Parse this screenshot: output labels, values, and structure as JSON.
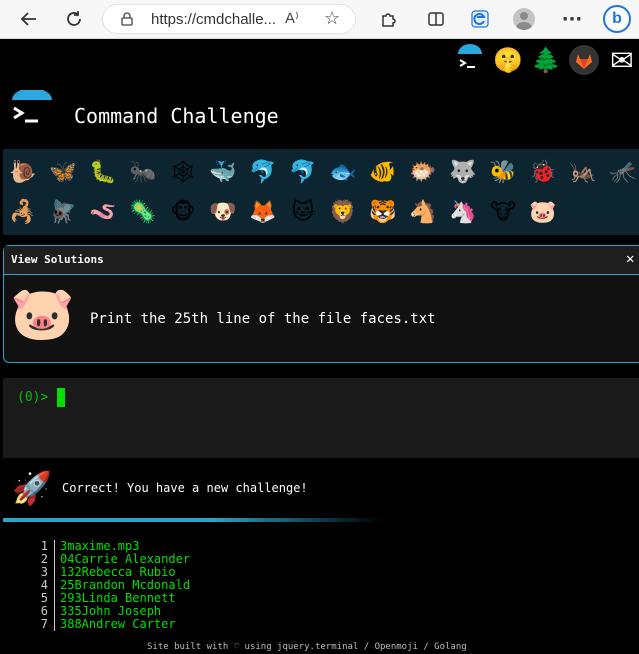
{
  "browser": {
    "url": "https://cmdchalle...",
    "reader_icon": "A⁾",
    "icons": [
      "back-arrow-icon",
      "refresh-icon",
      "lock-icon",
      "star-icon",
      "extensions-icon",
      "split-screen-icon",
      "edge-icon",
      "profile-icon",
      "more-icon",
      "bing-icon"
    ],
    "more": "···",
    "bing": "b"
  },
  "header": {
    "top_icons": [
      {
        "name": "terminal-logo-icon",
        "glyph": ""
      },
      {
        "name": "shushing-face-icon",
        "glyph": "🤫"
      },
      {
        "name": "tree-icon",
        "glyph": "🌲"
      },
      {
        "name": "gitlab-icon",
        "glyph": ""
      },
      {
        "name": "envelope-icon",
        "glyph": "✉"
      }
    ],
    "title": "Command Challenge"
  },
  "emoji_rows": [
    [
      "🐌",
      "🦋",
      "🐛",
      "🐜",
      "🕸",
      "🐳",
      "🐬",
      "🐬",
      "🐟",
      "🐠",
      "🐡",
      "🐺",
      "🐝",
      "🐞",
      "🦗",
      "🦟"
    ],
    [
      "🦂",
      "🪰",
      "🪱",
      "🦠",
      "🐵",
      "🐶",
      "🦊",
      "🐱",
      "🦁",
      "🐯",
      "🐴",
      "🦄",
      "🐮",
      "🐷"
    ]
  ],
  "challenge": {
    "view_solutions": "View Solutions",
    "close": "✕",
    "animal": "🐷",
    "task": "Print the 25th line of the file faces.txt"
  },
  "terminal": {
    "prompt": "(0)>"
  },
  "result": {
    "icon": "🚀",
    "message": "Correct! You have a new challenge!"
  },
  "output_lines": [
    {
      "n": "1",
      "text": "3maxime.mp3"
    },
    {
      "n": "2",
      "text": "04Carrie Alexander"
    },
    {
      "n": "3",
      "text": "132Rebecca Rubio"
    },
    {
      "n": "4",
      "text": "25Brandon Mcdonald"
    },
    {
      "n": "5",
      "text": "293Linda Bennett"
    },
    {
      "n": "6",
      "text": "335John Joseph"
    },
    {
      "n": "7",
      "text": "388Andrew Carter"
    }
  ],
  "footer": "Site built with ♡ using jquery.terminal / Openmoji / Golang",
  "colors": {
    "accent": "#2aa4c9",
    "terminal_green": "#00e000",
    "emoji_bg": "#0c2530"
  }
}
